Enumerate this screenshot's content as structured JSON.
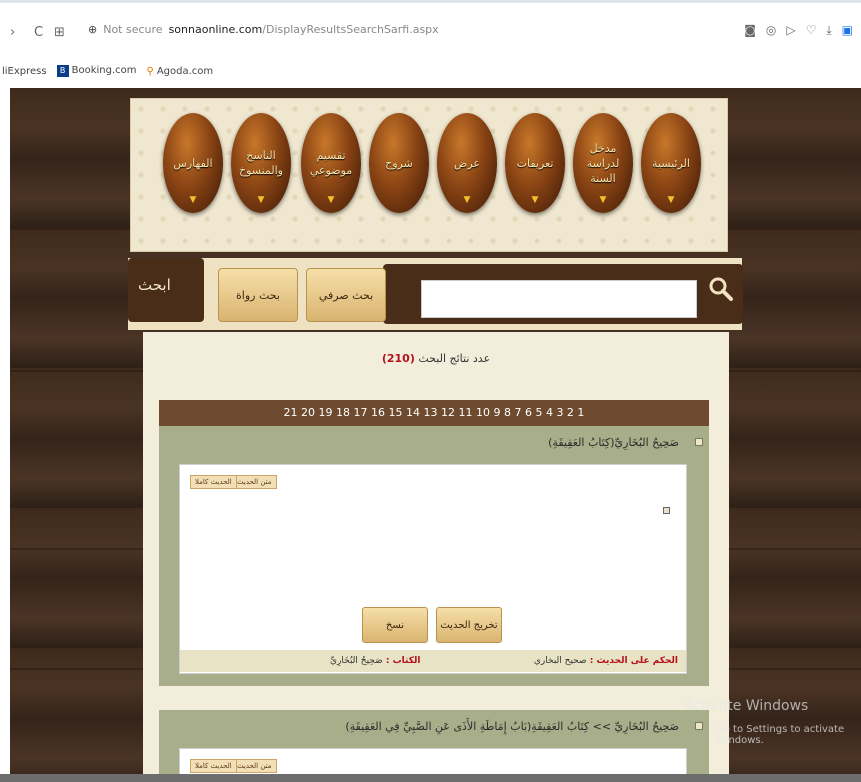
{
  "browser": {
    "nav_back": "›",
    "nav_reload": "C",
    "nav_grid": "⊞",
    "secure_label": "Not secure",
    "url_host": "sonnaonline.com",
    "url_path": "/DisplayResultsSearchSarfi.aspx",
    "bookmarks": [
      "liExpress",
      "Booking.com",
      "Agoda.com"
    ],
    "right_icons": [
      "camera-icon",
      "shield-icon",
      "play-icon",
      "heart-icon",
      "download-icon",
      "profile-icon"
    ]
  },
  "menu": {
    "items": [
      {
        "label": "الرئيسية"
      },
      {
        "label": "مدخل لدراسة السنة"
      },
      {
        "label": "تعريفات"
      },
      {
        "label": "عرض"
      },
      {
        "label": "شروح"
      },
      {
        "label": "تقسيم موضوعي"
      },
      {
        "label": "الناسخ والمنسوخ"
      },
      {
        "label": "الفهارس"
      }
    ]
  },
  "search": {
    "title": "ابحث",
    "btn_narrators": "بحث رواة",
    "btn_morph": "بحث صرفي",
    "input_value": ""
  },
  "results": {
    "count_label": "عدد نتائج البحث",
    "count_value": "(210)",
    "pages": "21 20 19 18 17 16 15 14 13 12 11 10 9 8 7 6 5 4 3 2 1",
    "blocks": [
      {
        "title": "صَحِيحُ البُخَارِيِّ(كِتَابُ العَقِيقَةِ)",
        "btn_text": "متن الحديث",
        "btn_full": "الحديث كاملا",
        "btn_takhrij": "تخريج الحديث",
        "btn_copy": "نسخ",
        "ruling_label": "الحكم على الحديث :",
        "ruling_value": "صحيح البخاري",
        "book_label": "الكتاب :",
        "book_value": "صَحِيحُ البُخَارِيِّ"
      },
      {
        "title": "صَحِيحُ البُخَارِيِّ >> كِتَابُ العَقِيقَةِ(بَابُ إِمَاطَةِ الأَذَى عَنِ الصَّبِيِّ فِي العَقِيقَةِ)",
        "btn_text": "متن الحديث",
        "btn_full": "الحديث كاملا"
      }
    ]
  },
  "watermark": {
    "line1": "Activate Windows",
    "line2": "Go to Settings to activate Windows."
  }
}
